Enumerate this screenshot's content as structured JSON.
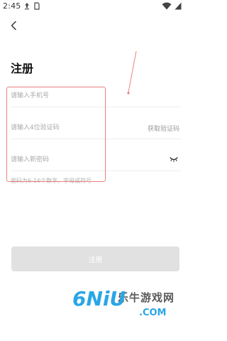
{
  "status_bar": {
    "time": "2:45",
    "icons": [
      "upload-icon",
      "sim-icon",
      "wifi-icon",
      "battery-icon"
    ]
  },
  "header": {
    "back_icon": "chevron-left-icon",
    "title": "注册"
  },
  "form": {
    "phone": {
      "placeholder": "请输入手机号",
      "value": ""
    },
    "code": {
      "placeholder": "请输入4位验证码",
      "value": "",
      "get_code_label": "获取验证码"
    },
    "password": {
      "placeholder": "请输入新密码",
      "value": "",
      "toggle_icon": "eye-closed-icon"
    },
    "hint": "密码为6-16个数字、字母或符号",
    "submit_label": "注册"
  },
  "watermark": {
    "name": "乐牛游戏网",
    "logo": "6NiU",
    "domain": ".COM"
  },
  "colors": {
    "annotation": "#e9817f",
    "button_disabled": "#e1e1e1",
    "placeholder": "#a9a9a9",
    "brand_blue": "#2aa6e6"
  }
}
